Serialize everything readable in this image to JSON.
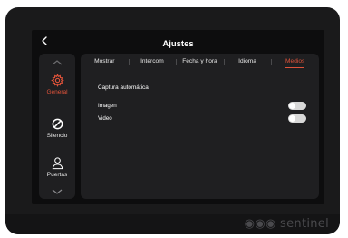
{
  "header": {
    "title": "Ajustes"
  },
  "sidebar": {
    "items": [
      {
        "label": "General",
        "icon": "gear-icon",
        "active": true
      },
      {
        "label": "Silencio",
        "icon": "mute-icon",
        "active": false
      },
      {
        "label": "Puertas",
        "icon": "user-icon",
        "active": false
      }
    ]
  },
  "tabs": [
    {
      "label": "Mostrar"
    },
    {
      "label": "Intercom"
    },
    {
      "label": "Fecha y hora"
    },
    {
      "label": "Idioma"
    },
    {
      "label": "Medios",
      "active": true
    }
  ],
  "content": {
    "section_title": "Captura automática",
    "rows": [
      {
        "label": "Imagen",
        "enabled": false
      },
      {
        "label": "Video",
        "enabled": false
      }
    ]
  },
  "brand": "sentinel",
  "colors": {
    "accent": "#e0533a",
    "panel": "#1f1f21",
    "screen": "#0d0d0e"
  }
}
